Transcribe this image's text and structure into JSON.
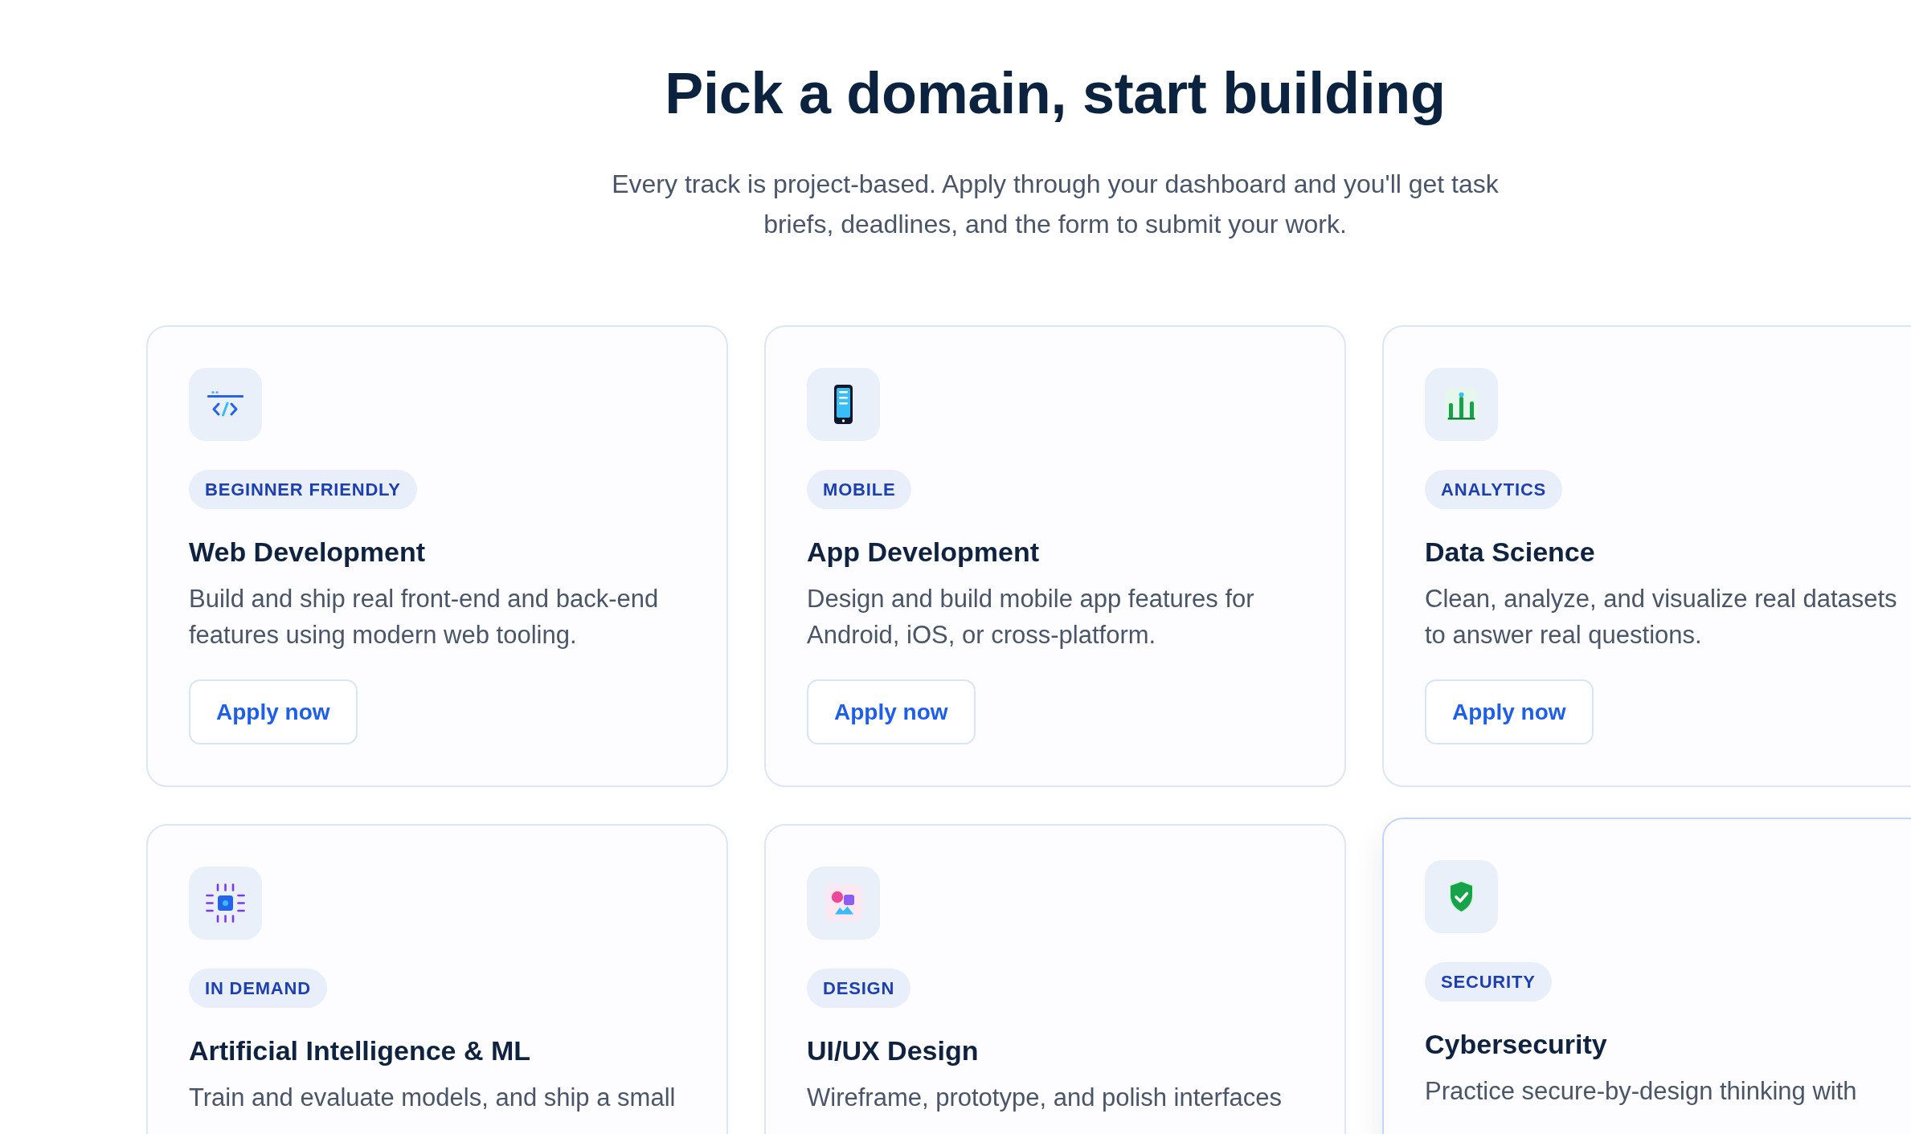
{
  "heading": {
    "title": "Pick a domain, start building",
    "subtitle": "Every track is project-based. Apply through your dashboard and you'll get task briefs, deadlines, and the form to submit your work."
  },
  "tracks": [
    {
      "kind": "code",
      "badge": "BEGINNER FRIENDLY",
      "title": "Web Development",
      "description": "Build and ship real front-end and back-end features using modern web tooling.",
      "action": "Apply now",
      "hovered": false
    },
    {
      "kind": "mobile",
      "badge": "MOBILE",
      "title": "App Development",
      "description": "Design and build mobile app features for Android, iOS, or cross-platform.",
      "action": "Apply now",
      "hovered": false
    },
    {
      "kind": "chart",
      "badge": "ANALYTICS",
      "title": "Data Science",
      "description": "Clean, analyze, and visualize real datasets to answer real questions.",
      "action": "Apply now",
      "hovered": false
    },
    {
      "kind": "chip",
      "badge": "IN DEMAND",
      "title": "Artificial Intelligence & ML",
      "description": "Train and evaluate models, and ship a small",
      "hovered": false
    },
    {
      "kind": "design",
      "badge": "DESIGN",
      "title": "UI/UX Design",
      "description": "Wireframe, prototype, and polish interfaces",
      "hovered": false
    },
    {
      "kind": "shield",
      "badge": "SECURITY",
      "title": "Cybersecurity",
      "description": "Practice secure-by-design thinking with",
      "hovered": true
    }
  ]
}
